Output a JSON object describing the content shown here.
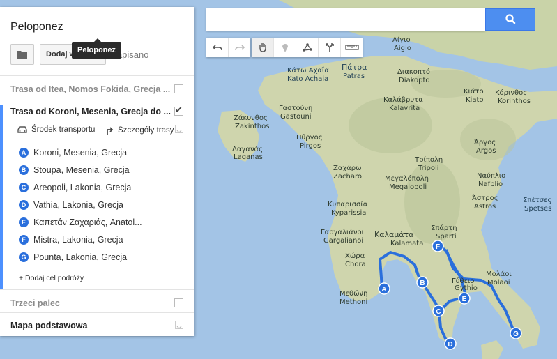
{
  "panel": {
    "title": "Peloponez",
    "tooltip": "Peloponez",
    "add_directions_label": "Dodaj warstwę",
    "saved_label": "Zapisano",
    "layers": [
      {
        "title": "Trasa od Itea, Nomos Fokida, Grecja ...",
        "checked": false
      },
      {
        "title": "Trasa od Koroni, Mesenia, Grecja do ...",
        "checked": true
      },
      {
        "title": "Trzeci palec",
        "checked": false
      }
    ],
    "transport_label": "Środek transportu",
    "route_details_label": "Szczegóły trasy",
    "waypoints": [
      {
        "marker": "A",
        "label": "Koroni, Mesenia, Grecja"
      },
      {
        "marker": "B",
        "label": "Stoupa, Mesenia, Grecja"
      },
      {
        "marker": "C",
        "label": "Areopoli, Lakonia, Grecja"
      },
      {
        "marker": "D",
        "label": "Vathia, Lakonia, Grecja"
      },
      {
        "marker": "E",
        "label": "Καπετάν Ζαχαριάς, Anatol..."
      },
      {
        "marker": "F",
        "label": "Mistra, Lakonia, Grecja"
      },
      {
        "marker": "G",
        "label": "Pounta, Lakonia, Grecja"
      }
    ],
    "add_destination": "+ Dodaj cel podróży",
    "base_map_label": "Mapa podstawowa"
  },
  "search": {
    "value": "",
    "placeholder": ""
  },
  "icons": {
    "folder": "folder-icon",
    "search": "search-icon",
    "undo": "undo-icon",
    "redo": "redo-icon",
    "hand": "hand-icon",
    "marker": "marker-icon",
    "line": "draw-line-icon",
    "directions": "directions-icon",
    "ruler": "ruler-icon",
    "car": "car-icon",
    "turn": "turn-arrow-icon"
  },
  "colors": {
    "sea": "#a3c4e6",
    "accent": "#4d90fe",
    "route": "#2a6fdc"
  },
  "map_labels": [
    {
      "text": "Αίγιο"
    },
    {
      "text": "Aigio"
    },
    {
      "text": "Κάτω Αχαΐα"
    },
    {
      "text": "Kato Achaia"
    },
    {
      "text": "Πάτρα"
    },
    {
      "text": "Patras"
    },
    {
      "text": "Διακοπτό"
    },
    {
      "text": "Diakopto"
    },
    {
      "text": "Καλάβρυτα"
    },
    {
      "text": "Kalavrita"
    },
    {
      "text": "Κιάτο"
    },
    {
      "text": "Kiato"
    },
    {
      "text": "Κόρινθος"
    },
    {
      "text": "Korinthos"
    },
    {
      "text": "Γαστούνη"
    },
    {
      "text": "Gastouni"
    },
    {
      "text": "Ζάκυνθος"
    },
    {
      "text": "Zakinthos"
    },
    {
      "text": "Λαγανάς"
    },
    {
      "text": "Laganas"
    },
    {
      "text": "Πύργος"
    },
    {
      "text": "Pirgos"
    },
    {
      "text": "Άργος"
    },
    {
      "text": "Argos"
    },
    {
      "text": "Τρίπολη"
    },
    {
      "text": "Tripoli"
    },
    {
      "text": "Ναύπλιο"
    },
    {
      "text": "Nafplio"
    },
    {
      "text": "Ζαχάρω"
    },
    {
      "text": "Zacharo"
    },
    {
      "text": "Μεγαλόπολη"
    },
    {
      "text": "Megalopoli"
    },
    {
      "text": "Κυπαρισσία"
    },
    {
      "text": "Kyparissia"
    },
    {
      "text": "Άστρος"
    },
    {
      "text": "Astros"
    },
    {
      "text": "Σπέτσες"
    },
    {
      "text": "Spetses"
    },
    {
      "text": "Γαργαλιάνοι"
    },
    {
      "text": "Gargalianoi"
    },
    {
      "text": "Καλαμάτα"
    },
    {
      "text": "Kalamata"
    },
    {
      "text": "Σπάρτη"
    },
    {
      "text": "Sparti"
    },
    {
      "text": "Χώρα"
    },
    {
      "text": "Chora"
    },
    {
      "text": "Μολάοι"
    },
    {
      "text": "Molaoi"
    },
    {
      "text": "Μεθώνη"
    },
    {
      "text": "Methoni"
    },
    {
      "text": "Γύθειο"
    },
    {
      "text": "Gythio"
    }
  ]
}
